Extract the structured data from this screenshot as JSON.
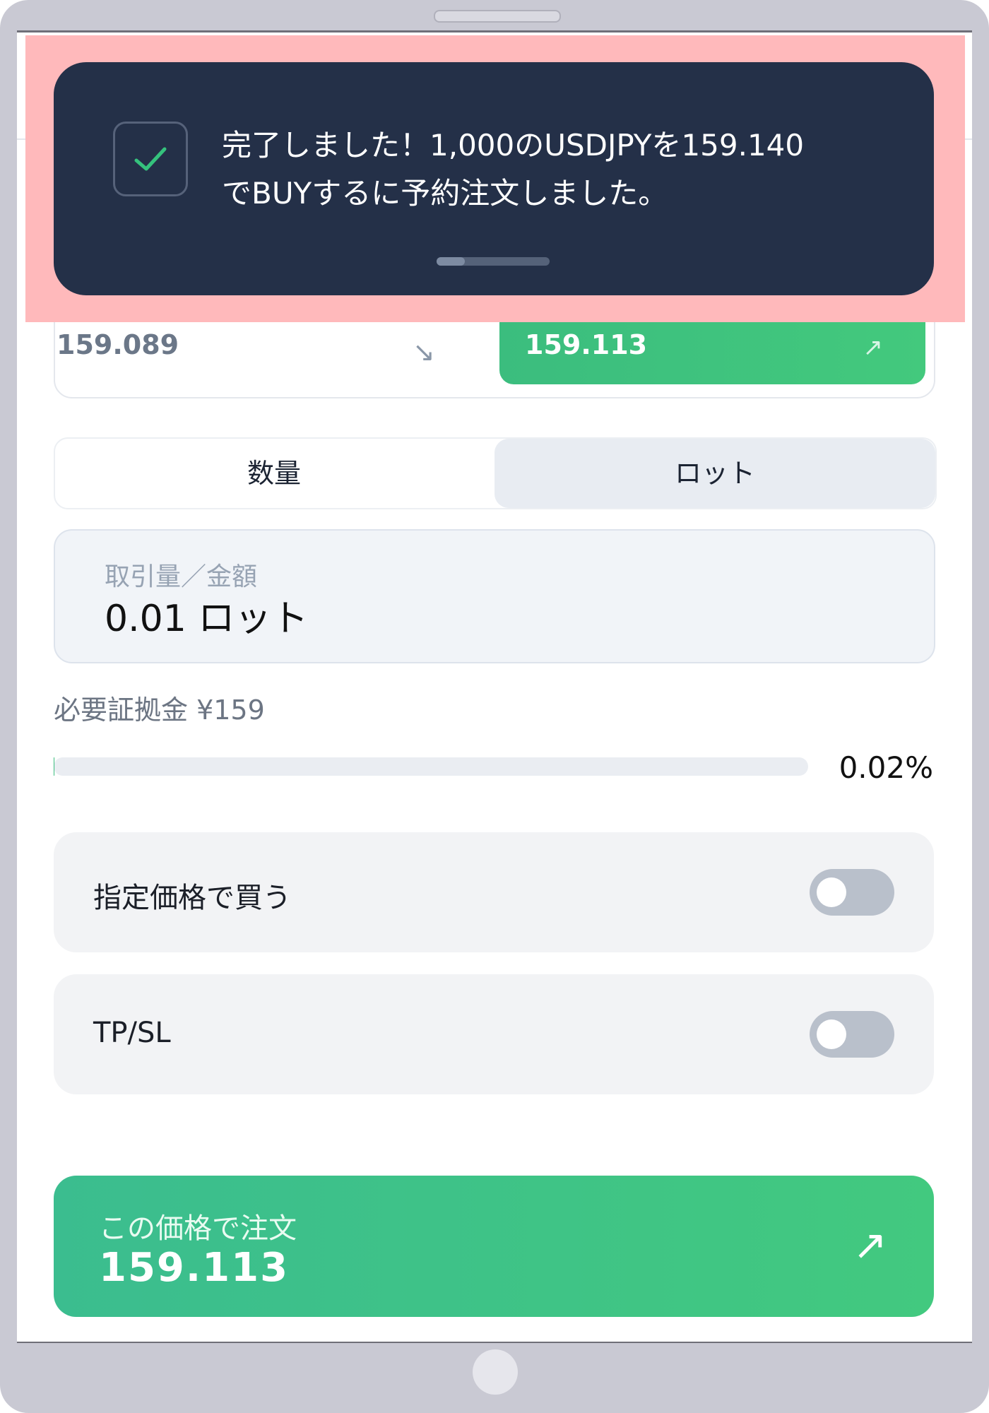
{
  "toast": {
    "message_line1": "完了しました！1,000のUSDJPYを159.140",
    "message_line2": "でBUYするに予約注文しました。"
  },
  "prices": {
    "sell_price": "159.089",
    "buy_price": "159.113"
  },
  "order_type": {
    "quantity_label": "数量",
    "lot_label": "ロット",
    "selected": "ロット"
  },
  "amount": {
    "label": "取引量／金額",
    "value": "0.01 ロット"
  },
  "margin": {
    "label": "必要証拠金 ¥159",
    "percent_text": "0.02%",
    "percent_value": 0.02
  },
  "limit_price": {
    "label": "指定価格で買う",
    "enabled": false
  },
  "tpsl": {
    "label": "TP/SL",
    "enabled": false
  },
  "order_button": {
    "label": "この価格で注文",
    "price": "159.113"
  },
  "colors": {
    "buy_green": "#3bbd7e",
    "toast_bg": "#243048",
    "highlight": "#ffb9bb"
  }
}
